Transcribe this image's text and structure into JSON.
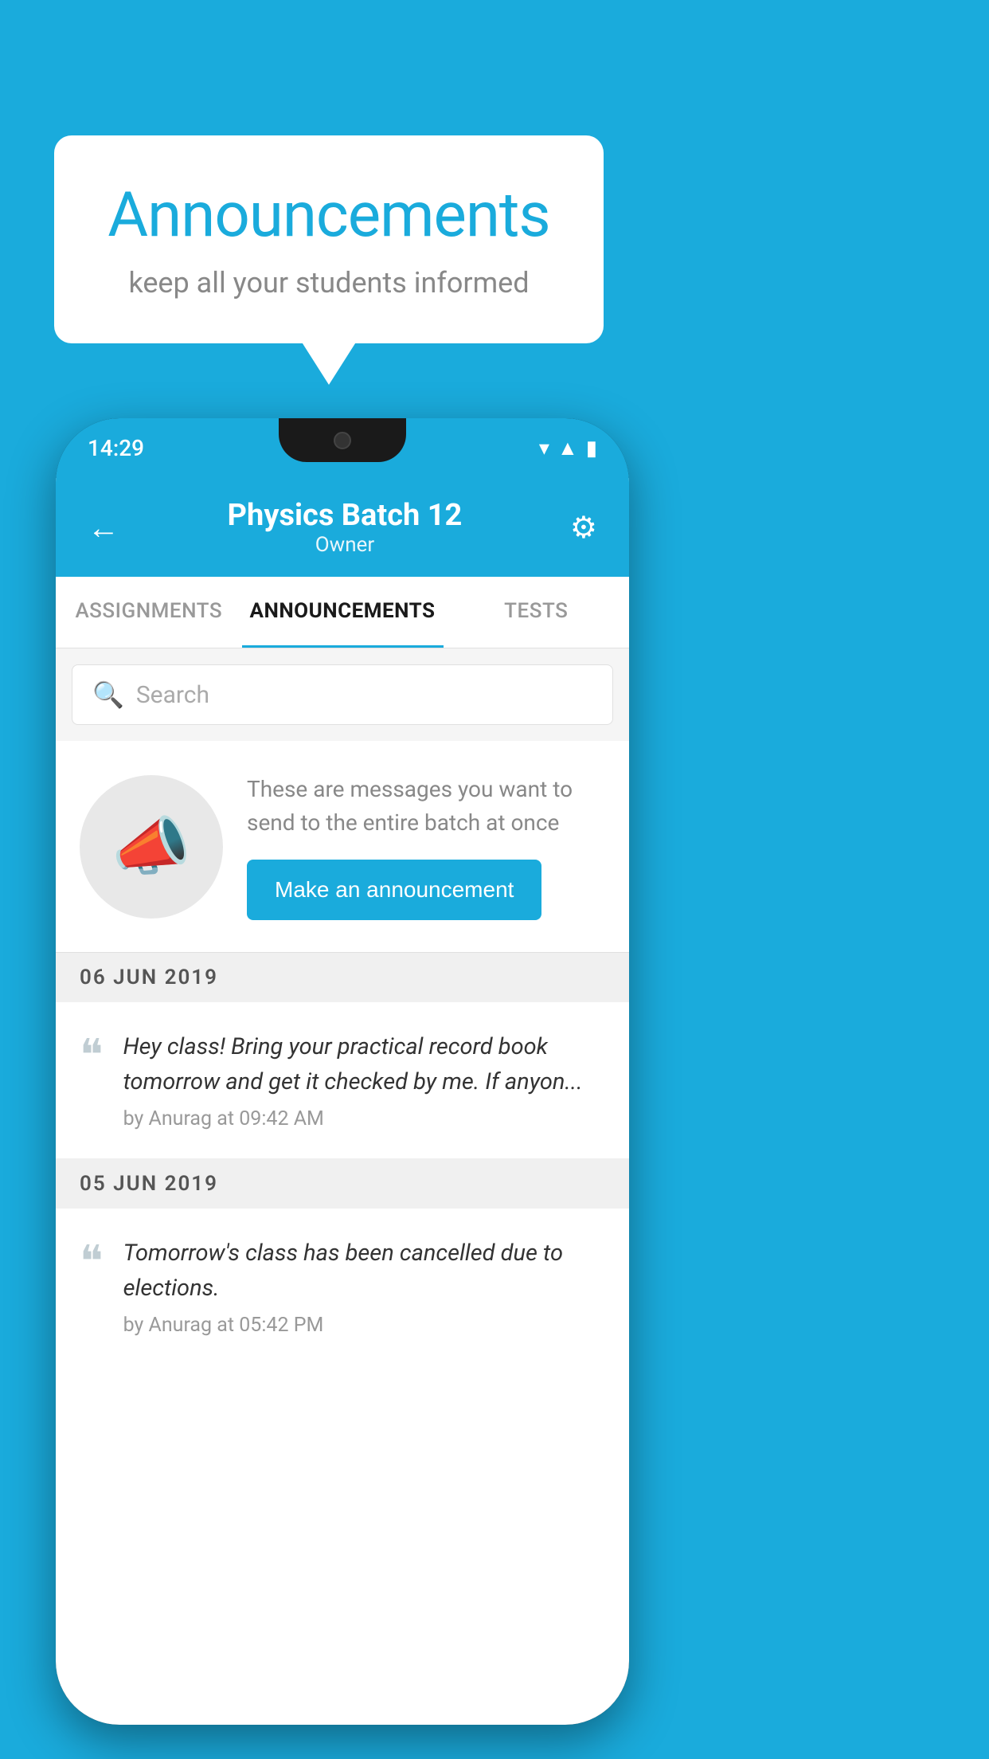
{
  "background_color": "#1AABDC",
  "speech_bubble": {
    "title": "Announcements",
    "subtitle": "keep all your students informed"
  },
  "phone": {
    "status_bar": {
      "time": "14:29"
    },
    "header": {
      "back_label": "←",
      "title": "Physics Batch 12",
      "subtitle": "Owner",
      "settings_icon": "⚙"
    },
    "tabs": [
      {
        "label": "ASSIGNMENTS",
        "active": false
      },
      {
        "label": "ANNOUNCEMENTS",
        "active": true
      },
      {
        "label": "TESTS",
        "active": false
      }
    ],
    "search": {
      "placeholder": "Search"
    },
    "promo": {
      "description": "These are messages you want to send to the entire batch at once",
      "button_label": "Make an announcement"
    },
    "announcements": [
      {
        "date": "06  JUN  2019",
        "message": "Hey class! Bring your practical record book tomorrow and get it checked by me. If anyon...",
        "author": "by Anurag at 09:42 AM"
      },
      {
        "date": "05  JUN  2019",
        "message": "Tomorrow's class has been cancelled due to elections.",
        "author": "by Anurag at 05:42 PM"
      }
    ]
  }
}
